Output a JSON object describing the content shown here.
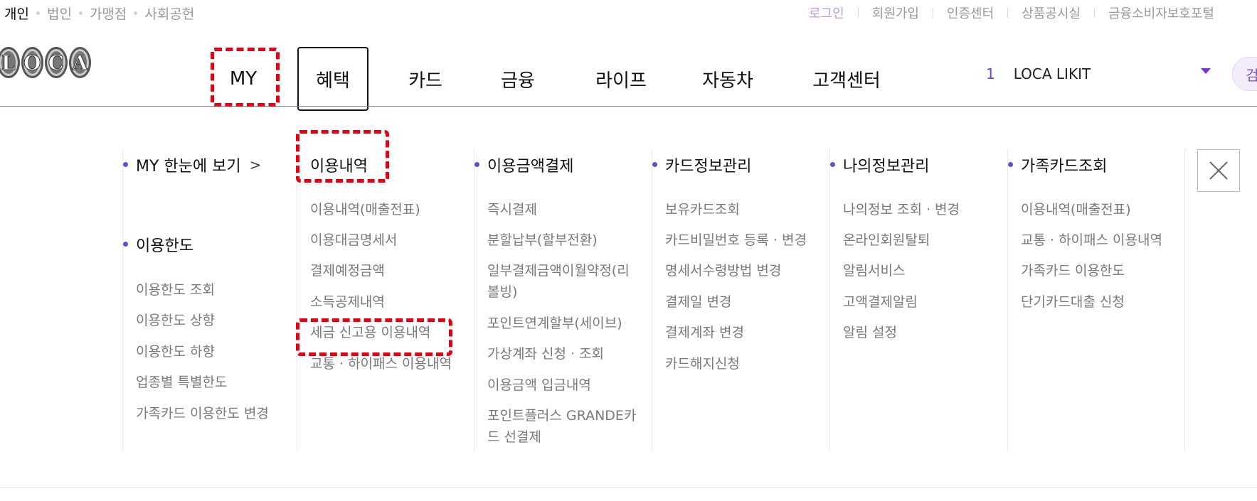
{
  "top_segments": [
    "개인",
    "법인",
    "가맹점",
    "사회공헌"
  ],
  "utility_links": [
    "로그인",
    "회원가입",
    "인증센터",
    "상품공시실",
    "금융소비자보호포털"
  ],
  "logo_letters": [
    "L",
    "O",
    "C",
    "A"
  ],
  "nav": [
    "MY",
    "혜택",
    "카드",
    "금융",
    "라이프",
    "자동차",
    "고객센터"
  ],
  "card_selector": {
    "index": "1",
    "name": "LOCA LIKIT"
  },
  "search_label": "검",
  "menu": {
    "col1": {
      "heading1": "MY 한눈에 보기",
      "chevron": ">",
      "heading2": "이용한도",
      "items": [
        "이용한도 조회",
        "이용한도 상향",
        "이용한도 하향",
        "업종별 특별한도",
        "가족카드 이용한도 변경"
      ]
    },
    "col2": {
      "heading": "이용내역",
      "items": [
        "이용내역(매출전표)",
        "이용대금명세서",
        "결제예정금액",
        "소득공제내역",
        "세금 신고용 이용내역",
        "교통 · 하이패스 이용내역"
      ]
    },
    "col3": {
      "heading": "이용금액결제",
      "items": [
        "즉시결제",
        "분할납부(할부전환)",
        "일부결제금액이월약정(리볼빙)",
        "포인트연계할부(세이브)",
        "가상계좌 신청 · 조회",
        "이용금액 입금내역",
        "포인트플러스 GRANDE카드 선결제"
      ]
    },
    "col4": {
      "heading": "카드정보관리",
      "items": [
        "보유카드조회",
        "카드비밀번호 등록 · 변경",
        "명세서수령방법 변경",
        "결제일 변경",
        "결제계좌 변경",
        "카드해지신청"
      ]
    },
    "col5": {
      "heading": "나의정보관리",
      "items": [
        "나의정보 조회 · 변경",
        "온라인회원탈퇴",
        "알림서비스",
        "고액결제알림",
        "알림 설정"
      ]
    },
    "col6": {
      "heading": "가족카드조회",
      "items": [
        "이용내역(매출전표)",
        "교통 · 하이패스 이용내역",
        "가족카드 이용한도",
        "단기카드대출 신청"
      ]
    }
  }
}
